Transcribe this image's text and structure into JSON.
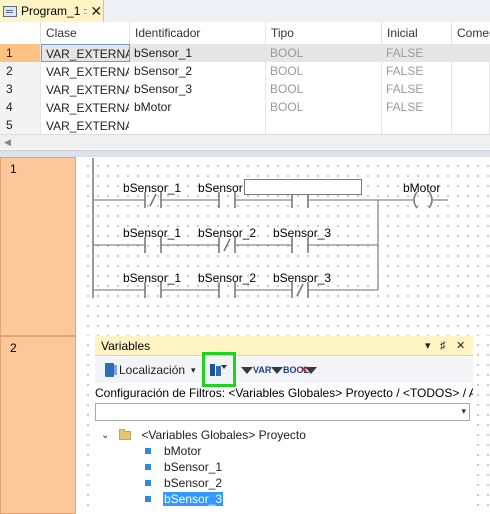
{
  "tab": {
    "title": "Program_1",
    "pin_glyph": "::",
    "close_glyph": "✕"
  },
  "var_table": {
    "headers": [
      "Clase",
      "Identificador",
      "Tipo",
      "Inicial",
      "Comen"
    ],
    "rows": [
      {
        "num": "1",
        "clase": "VAR_EXTERNAL",
        "id": "bSensor_1",
        "tipo": "BOOL",
        "inicial": "FALSE"
      },
      {
        "num": "2",
        "clase": "VAR_EXTERNAL",
        "id": "bSensor_2",
        "tipo": "BOOL",
        "inicial": "FALSE"
      },
      {
        "num": "3",
        "clase": "VAR_EXTERNAL",
        "id": "bSensor_3",
        "tipo": "BOOL",
        "inicial": "FALSE"
      },
      {
        "num": "4",
        "clase": "VAR_EXTERNAL",
        "id": "bMotor",
        "tipo": "BOOL",
        "inicial": "FALSE"
      },
      {
        "num": "5",
        "clase": "VAR_EXTERNAL",
        "id": "",
        "tipo": "",
        "inicial": ""
      }
    ],
    "scroll_arrow": "◀"
  },
  "networks": [
    {
      "number": "1",
      "rung1": {
        "c1": "bSensor_1",
        "c2": "bSensor",
        "coil": "bMotor"
      },
      "rung2": {
        "c1": "bSensor_1",
        "c2": "bSensor_2",
        "c3": "bSensor_3"
      },
      "rung3": {
        "c1": "bSensor_1",
        "c2": "bSensor_2",
        "c3": "bSensor_3"
      }
    },
    {
      "number": "2"
    }
  ],
  "variables_panel": {
    "title": "Variables",
    "title_buttons": {
      "dropdown": "▾",
      "pin": "♯",
      "close": "✕"
    },
    "toolbar": {
      "localizacion": "Localización",
      "dropdown": "▾",
      "var_label": "VAR",
      "bool_label": "BOOL"
    },
    "filter_config": "Configuración de Filtros: <Variables Globales> Proyecto / <TODOS> / ANY_",
    "combo_arrow": "▾",
    "tree": {
      "root_label": "<Variables Globales> Proyecto",
      "expander": "⌄",
      "items": [
        "bMotor",
        "bSensor_1",
        "bSensor_2",
        "bSensor_3"
      ],
      "selected_index": 3
    }
  },
  "colors": {
    "network_header": "#fcc79a",
    "tool_title": "#fff5c4",
    "selection": "#3399ff",
    "highlight": "#1fd31f",
    "row_selected": "#ffc285"
  }
}
